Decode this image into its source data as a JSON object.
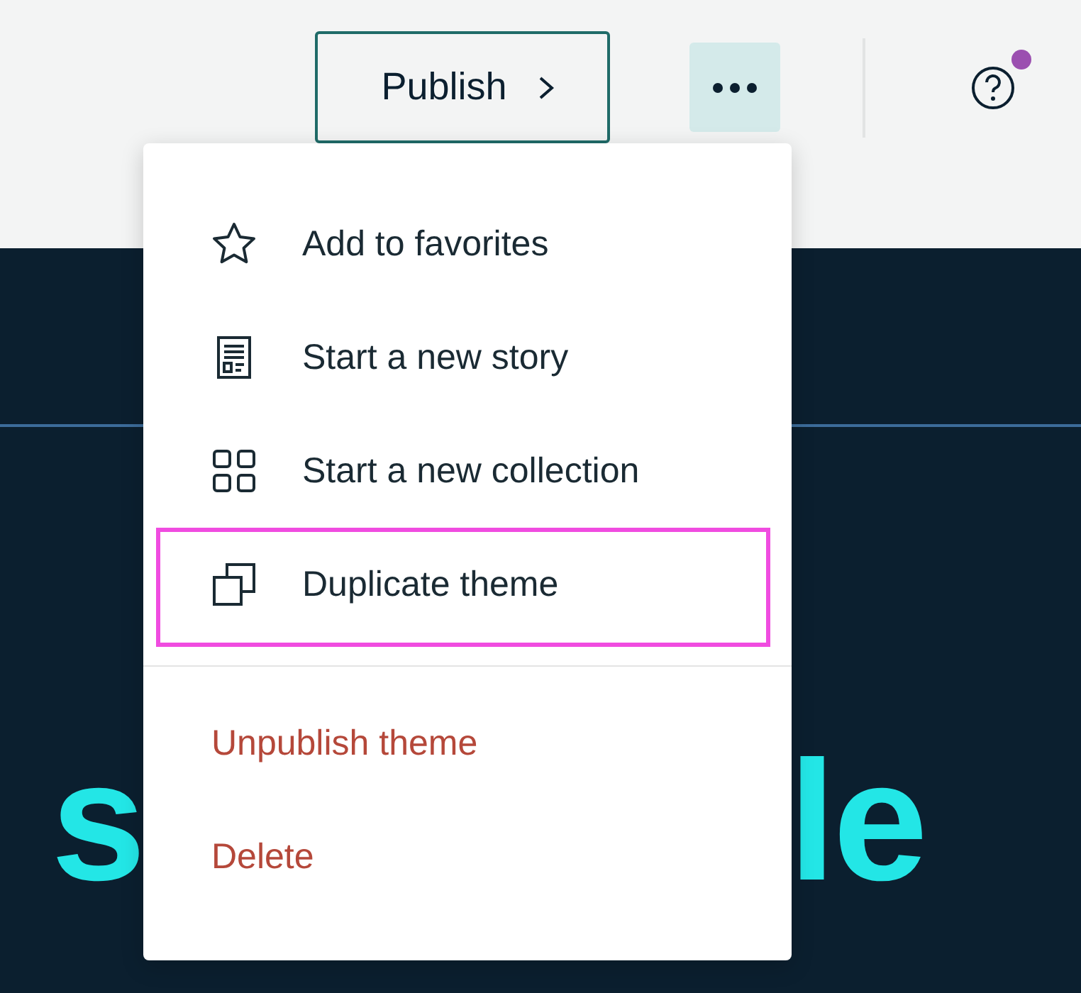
{
  "toolbar": {
    "publish_button": {
      "label": "Publish"
    },
    "more_button": {
      "selected": true
    },
    "help": {
      "notification": true
    }
  },
  "hero": {
    "headline_left": "s",
    "headline_right": "le"
  },
  "menu": {
    "groups": [
      {
        "items": [
          {
            "kind": "star",
            "label": "Add to favorites",
            "highlighted": false,
            "danger": false
          },
          {
            "kind": "story",
            "label": "Start a new story",
            "highlighted": false,
            "danger": false
          },
          {
            "kind": "grid",
            "label": "Start a new collection",
            "highlighted": false,
            "danger": false
          },
          {
            "kind": "duplicate",
            "label": "Duplicate theme",
            "highlighted": true,
            "danger": false
          }
        ]
      },
      {
        "items": [
          {
            "kind": "none",
            "label": "Unpublish theme",
            "highlighted": false,
            "danger": true
          },
          {
            "kind": "none",
            "label": "Delete",
            "highlighted": false,
            "danger": true
          }
        ]
      }
    ]
  }
}
